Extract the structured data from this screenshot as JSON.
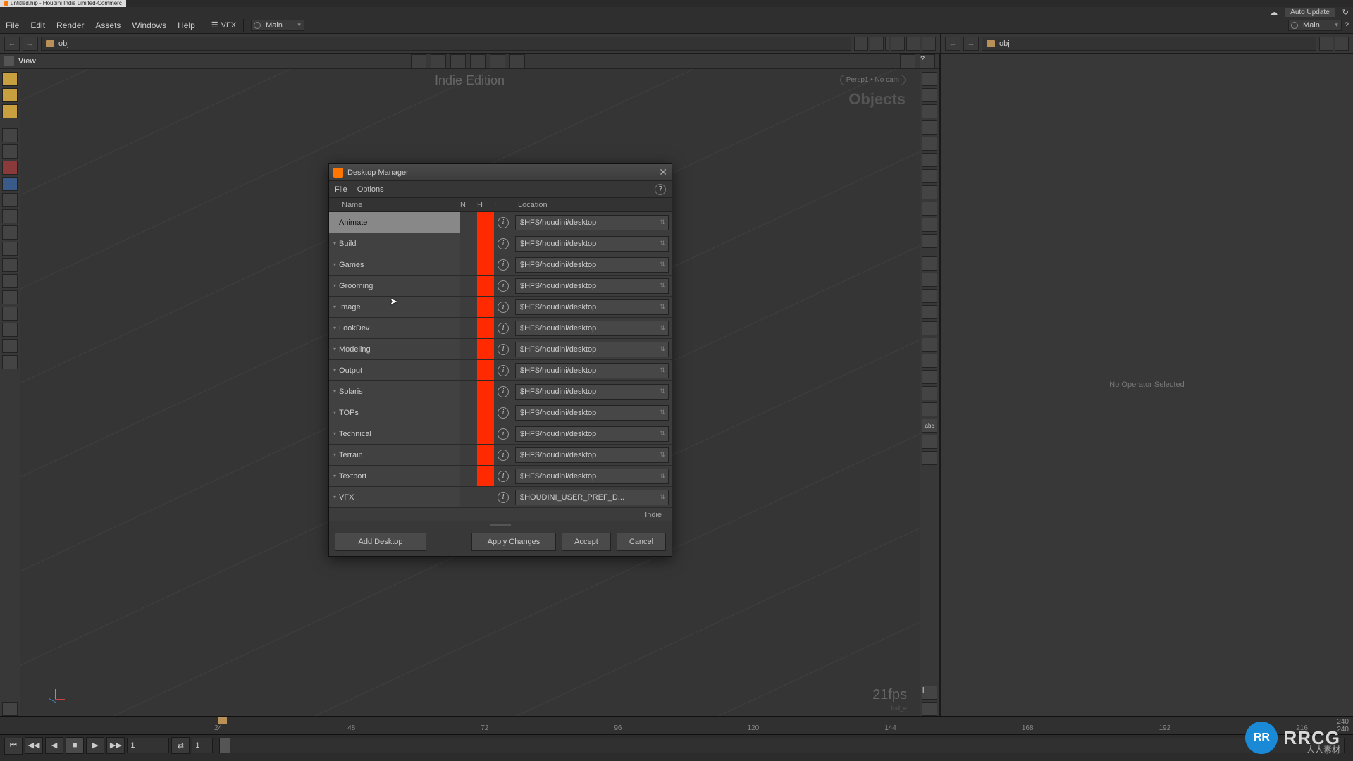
{
  "window": {
    "title": "untitled.hip - Houdini Indie Limited-Commerc"
  },
  "topstatus": {
    "auto_update": "Auto Update"
  },
  "menubar": {
    "items": [
      "File",
      "Edit",
      "Render",
      "Assets",
      "Windows",
      "Help"
    ],
    "shelf_vfx": "VFX",
    "shelf_main_left": "Main",
    "shelf_main_right": "Main"
  },
  "path": {
    "left": "obj",
    "right": "obj"
  },
  "view": {
    "label": "View",
    "edition": "Indie Edition",
    "objects": "Objects",
    "cam": "Persp1 • No cam",
    "fps": "21fps",
    "stat": "Ind_e"
  },
  "right_panel": {
    "no_op": "No Operator Selected"
  },
  "dialog": {
    "title": "Desktop Manager",
    "menu": {
      "file": "File",
      "options": "Options"
    },
    "columns": {
      "name": "Name",
      "n": "N",
      "h": "H",
      "i": "I",
      "location": "Location"
    },
    "rows": [
      {
        "name": "Animate",
        "h": true,
        "loc": "$HFS/houdini/desktop",
        "sel": true
      },
      {
        "name": "Build",
        "h": true,
        "loc": "$HFS/houdini/desktop"
      },
      {
        "name": "Games",
        "h": true,
        "loc": "$HFS/houdini/desktop"
      },
      {
        "name": "Grooming",
        "h": true,
        "loc": "$HFS/houdini/desktop"
      },
      {
        "name": "Image",
        "h": true,
        "loc": "$HFS/houdini/desktop"
      },
      {
        "name": "LookDev",
        "h": true,
        "loc": "$HFS/houdini/desktop"
      },
      {
        "name": "Modeling",
        "h": true,
        "loc": "$HFS/houdini/desktop"
      },
      {
        "name": "Output",
        "h": true,
        "loc": "$HFS/houdini/desktop"
      },
      {
        "name": "Solaris",
        "h": true,
        "loc": "$HFS/houdini/desktop"
      },
      {
        "name": "TOPs",
        "h": true,
        "loc": "$HFS/houdini/desktop"
      },
      {
        "name": "Technical",
        "h": true,
        "loc": "$HFS/houdini/desktop"
      },
      {
        "name": "Terrain",
        "h": true,
        "loc": "$HFS/houdini/desktop"
      },
      {
        "name": "Textport",
        "h": true,
        "loc": "$HFS/houdini/desktop"
      },
      {
        "name": "VFX",
        "h": false,
        "loc": "$HOUDINI_USER_PREF_D..."
      }
    ],
    "indie": "Indie",
    "buttons": {
      "add": "Add Desktop",
      "apply": "Apply Changes",
      "accept": "Accept",
      "cancel": "Cancel"
    }
  },
  "timeline": {
    "ticks": [
      "24",
      "48",
      "72",
      "96",
      "120",
      "144",
      "168",
      "192",
      "216"
    ],
    "end_top": "240",
    "end_bot": "240",
    "frame": "1",
    "start": "1"
  },
  "logo": {
    "badge": "RR",
    "text": "RRCG",
    "sub": "人人素材"
  }
}
